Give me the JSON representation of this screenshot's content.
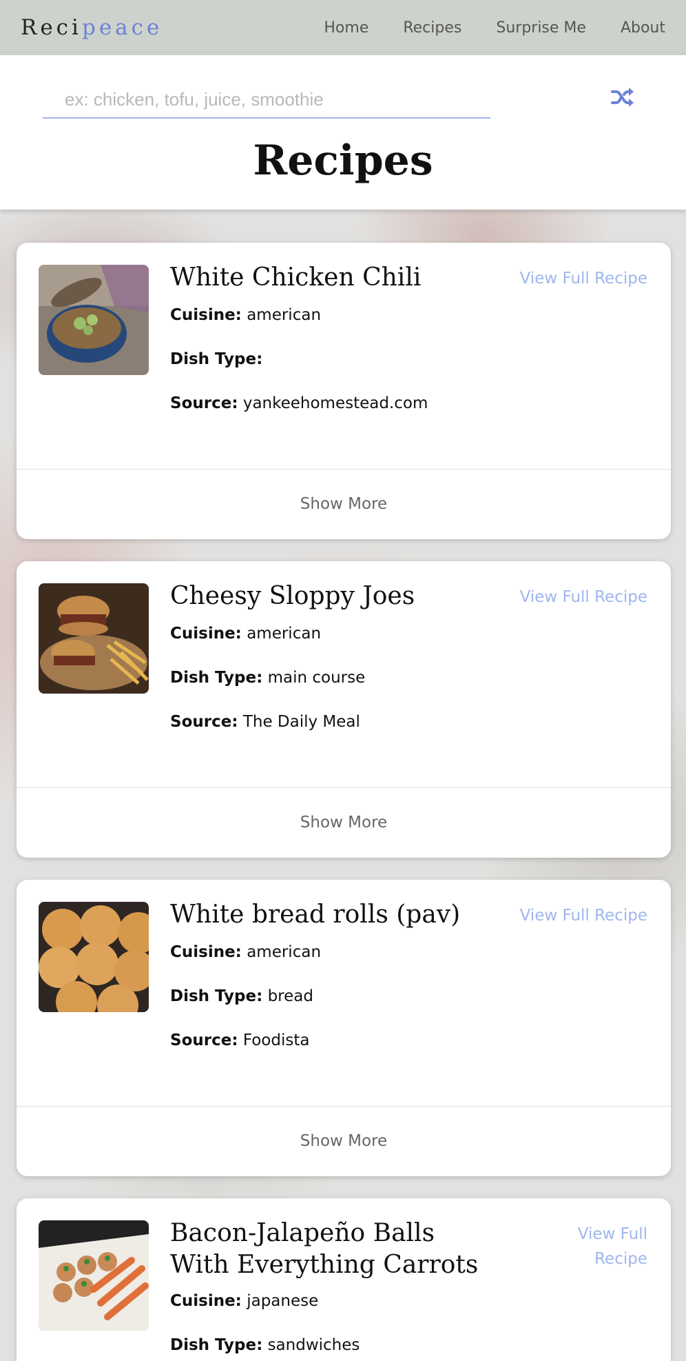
{
  "navbar": {
    "logo_part1": "Reci",
    "logo_part2": "peace",
    "links": [
      "Home",
      "Recipes",
      "Surprise Me",
      "About"
    ]
  },
  "search": {
    "placeholder": "ex: chicken, tofu, juice, smoothie",
    "value": ""
  },
  "page_title": "Recipes",
  "shuffle_icon": "shuffle-icon",
  "labels": {
    "cuisine": "Cuisine:",
    "dish_type": "Dish Type:",
    "source": "Source:",
    "view_full": "View Full Recipe",
    "show_more": "Show More"
  },
  "recipes": [
    {
      "title": "White Chicken Chili",
      "cuisine": "american",
      "dish_type": "",
      "source": "yankeehomestead.com"
    },
    {
      "title": "Cheesy Sloppy Joes",
      "cuisine": "american",
      "dish_type": "main course",
      "source": "The Daily Meal"
    },
    {
      "title": "White bread rolls (pav)",
      "cuisine": "american",
      "dish_type": "bread",
      "source": "Foodista"
    },
    {
      "title": "Bacon-Jalapeño Balls With Everything Carrots",
      "cuisine": "japanese",
      "dish_type": "sandwiches",
      "source": ""
    }
  ],
  "colors": {
    "accent": "#6b82d6",
    "link": "#9fb6ec",
    "navbar_bg": "#cdd2cc"
  }
}
